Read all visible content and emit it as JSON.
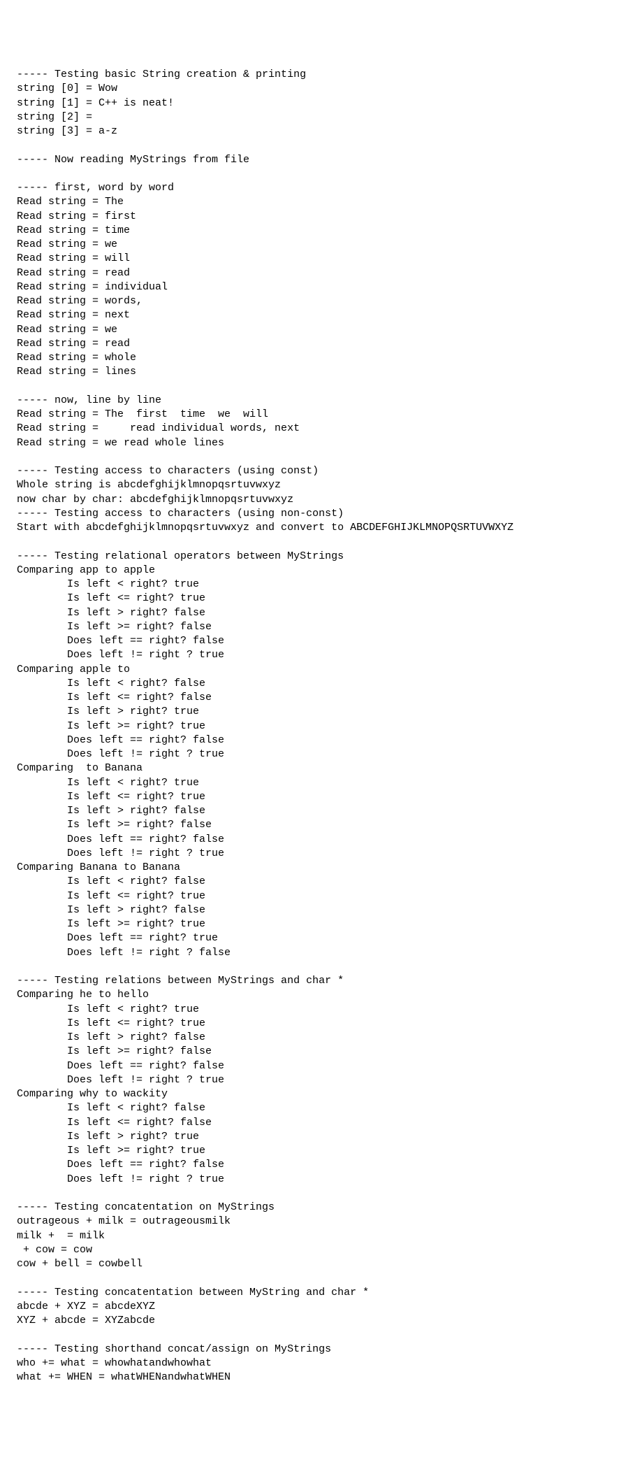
{
  "lines": [
    "----- Testing basic String creation & printing",
    "string [0] = Wow",
    "string [1] = C++ is neat!",
    "string [2] = ",
    "string [3] = a-z",
    "",
    "----- Now reading MyStrings from file",
    "",
    "----- first, word by word",
    "Read string = The",
    "Read string = first",
    "Read string = time",
    "Read string = we",
    "Read string = will",
    "Read string = read",
    "Read string = individual",
    "Read string = words,",
    "Read string = next",
    "Read string = we",
    "Read string = read",
    "Read string = whole",
    "Read string = lines",
    "",
    "----- now, line by line",
    "Read string = The  first  time  we  will",
    "Read string =     read individual words, next",
    "Read string = we read whole lines",
    "",
    "----- Testing access to characters (using const)",
    "Whole string is abcdefghijklmnopqsrtuvwxyz",
    "now char by char: abcdefghijklmnopqsrtuvwxyz",
    "----- Testing access to characters (using non-const)",
    "Start with abcdefghijklmnopqsrtuvwxyz and convert to ABCDEFGHIJKLMNOPQSRTUVWXYZ",
    "",
    "----- Testing relational operators between MyStrings",
    "Comparing app to apple",
    "        Is left < right? true",
    "        Is left <= right? true",
    "        Is left > right? false",
    "        Is left >= right? false",
    "        Does left == right? false",
    "        Does left != right ? true",
    "Comparing apple to ",
    "        Is left < right? false",
    "        Is left <= right? false",
    "        Is left > right? true",
    "        Is left >= right? true",
    "        Does left == right? false",
    "        Does left != right ? true",
    "Comparing  to Banana",
    "        Is left < right? true",
    "        Is left <= right? true",
    "        Is left > right? false",
    "        Is left >= right? false",
    "        Does left == right? false",
    "        Does left != right ? true",
    "Comparing Banana to Banana",
    "        Is left < right? false",
    "        Is left <= right? true",
    "        Is left > right? false",
    "        Is left >= right? true",
    "        Does left == right? true",
    "        Does left != right ? false",
    "",
    "----- Testing relations between MyStrings and char *",
    "Comparing he to hello",
    "        Is left < right? true",
    "        Is left <= right? true",
    "        Is left > right? false",
    "        Is left >= right? false",
    "        Does left == right? false",
    "        Does left != right ? true",
    "Comparing why to wackity",
    "        Is left < right? false",
    "        Is left <= right? false",
    "        Is left > right? true",
    "        Is left >= right? true",
    "        Does left == right? false",
    "        Does left != right ? true",
    "",
    "----- Testing concatentation on MyStrings",
    "outrageous + milk = outrageousmilk",
    "milk +  = milk",
    " + cow = cow",
    "cow + bell = cowbell",
    "",
    "----- Testing concatentation between MyString and char *",
    "abcde + XYZ = abcdeXYZ",
    "XYZ + abcde = XYZabcde",
    "",
    "----- Testing shorthand concat/assign on MyStrings",
    "who += what = whowhatandwhowhat",
    "what += WHEN = whatWHENandwhatWHEN"
  ]
}
